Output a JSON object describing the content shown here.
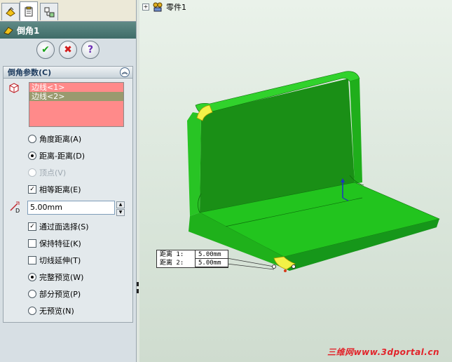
{
  "tree": {
    "root_label": "零件1",
    "expand_symbol": "+"
  },
  "feature": {
    "title": "倒角1"
  },
  "buttons": {
    "ok": "✔",
    "cancel": "✖",
    "help": "?"
  },
  "group": {
    "title": "倒角参数(C)",
    "edges": [
      "边线<1>",
      "边线<2>"
    ],
    "options": {
      "angle_distance": "角度距离(A)",
      "distance_distance": "距离-距离(D)",
      "vertex": "顶点(V)",
      "equal_distance": "相等距离(E)",
      "distance_value": "5.00mm",
      "select_through_faces": "通过面选择(S)",
      "keep_features": "保持特征(K)",
      "tangent_propagation": "切线延伸(T)",
      "full_preview": "完整预览(W)",
      "partial_preview": "部分预览(P)",
      "no_preview": "无预览(N)"
    }
  },
  "callout": {
    "rows": [
      {
        "label": "距离 1:",
        "value": "5.00mm"
      },
      {
        "label": "距离 2:",
        "value": "5.00mm"
      }
    ]
  },
  "watermark": "三维网www.3dportal.cn",
  "colors": {
    "part_green": "#22c41e",
    "dark_green": "#0d6d0b",
    "edge_list": "#ff8a8a",
    "title_bar": "#4f7b77"
  }
}
